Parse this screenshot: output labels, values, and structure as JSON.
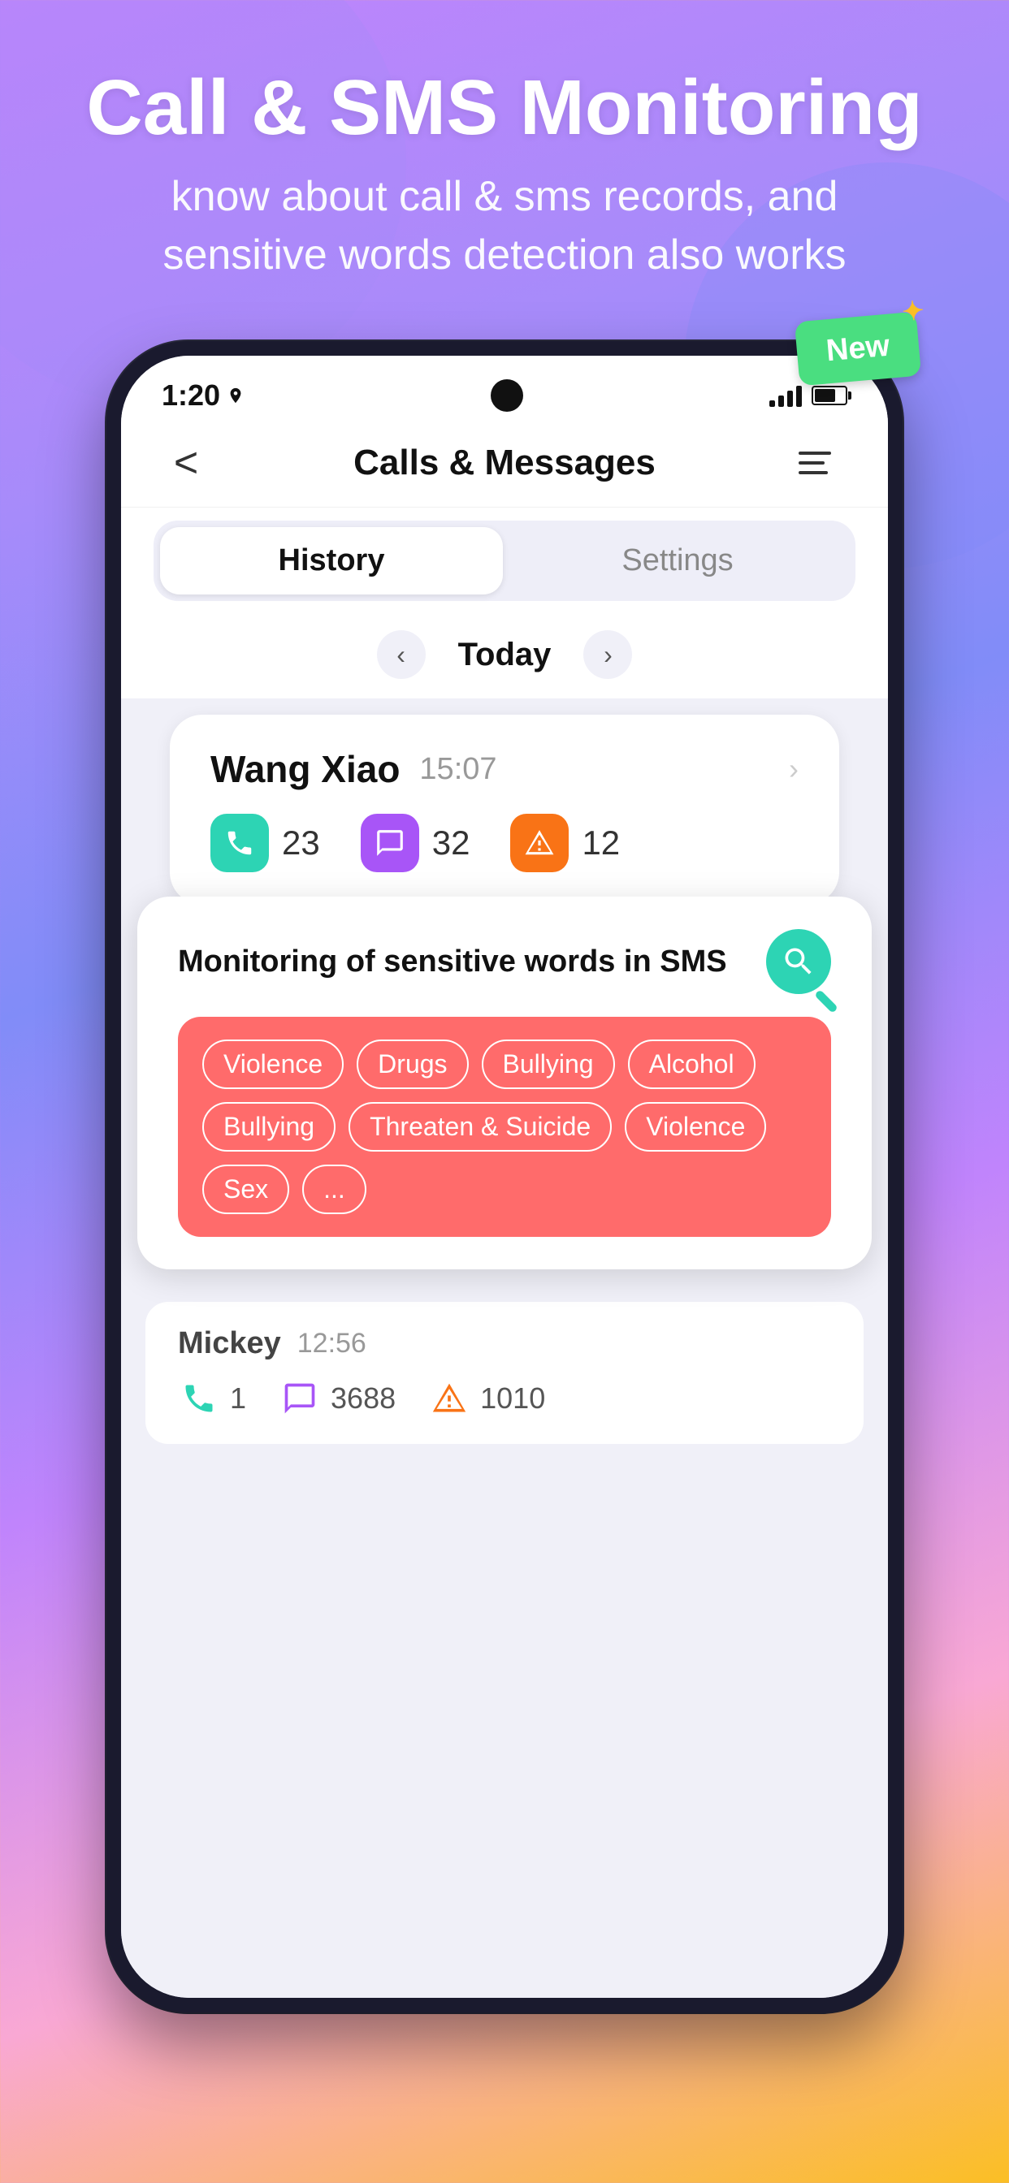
{
  "background": {
    "gradient": "linear-gradient(160deg, #c084fc 0%, #a78bfa 20%, #818cf8 40%, #c084fc 60%, #f9a8d4 80%, #fbbf24 100%)"
  },
  "hero": {
    "title": "Call & SMS Monitoring",
    "subtitle_line1": "know about call & sms records, and",
    "subtitle_line2": "sensitive words detection also works"
  },
  "new_badge": {
    "label": "New"
  },
  "status_bar": {
    "time": "1:20",
    "signal": "●●●",
    "battery": "70"
  },
  "header": {
    "back_label": "‹",
    "title": "Calls & Messages",
    "menu_label": "☰"
  },
  "tabs": {
    "history": "History",
    "settings": "Settings"
  },
  "date_nav": {
    "prev": "‹",
    "date": "Today",
    "next": "›"
  },
  "wang_xiao": {
    "name": "Wang Xiao",
    "time": "15:07",
    "calls": "23",
    "messages": "32",
    "alerts": "12"
  },
  "monitoring": {
    "title": "Monitoring of sensitive words in SMS",
    "tags": [
      "Violence",
      "Drugs",
      "Bullying",
      "Alcohol",
      "Bullying",
      "Threaten & Suicide",
      "Violence",
      "Sex",
      "..."
    ]
  },
  "mickey": {
    "name": "Mickey",
    "time": "12:56",
    "calls": "1",
    "messages": "3688",
    "alerts": "1010"
  }
}
